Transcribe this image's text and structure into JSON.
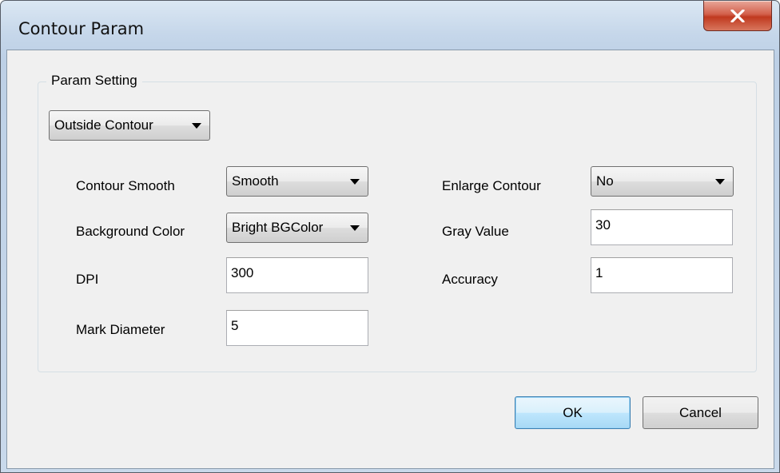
{
  "window": {
    "title": "Contour Param"
  },
  "colors": {
    "title_bar": "#c6d7ea",
    "close_button": "#c7432b",
    "dialog_bg": "#f0f0f0",
    "ok_focus_border": "#3c7fb1"
  },
  "close_button": {
    "icon": "close-icon",
    "label": "x"
  },
  "group": {
    "label": "Param Setting",
    "mode_select": {
      "value": "Outside Contour"
    }
  },
  "fields": {
    "contour_smooth": {
      "label": "Contour Smooth",
      "value": "Smooth"
    },
    "background_color": {
      "label": "Background Color",
      "value": "Bright BGColor"
    },
    "dpi": {
      "label": "DPI",
      "value": "300"
    },
    "mark_diameter": {
      "label": "Mark Diameter",
      "value": "5"
    },
    "enlarge_contour": {
      "label": "Enlarge Contour",
      "value": "No"
    },
    "gray_value": {
      "label": "Gray Value",
      "value": "30"
    },
    "accuracy": {
      "label": "Accuracy",
      "value": "1"
    }
  },
  "buttons": {
    "ok": "OK",
    "cancel": "Cancel"
  }
}
